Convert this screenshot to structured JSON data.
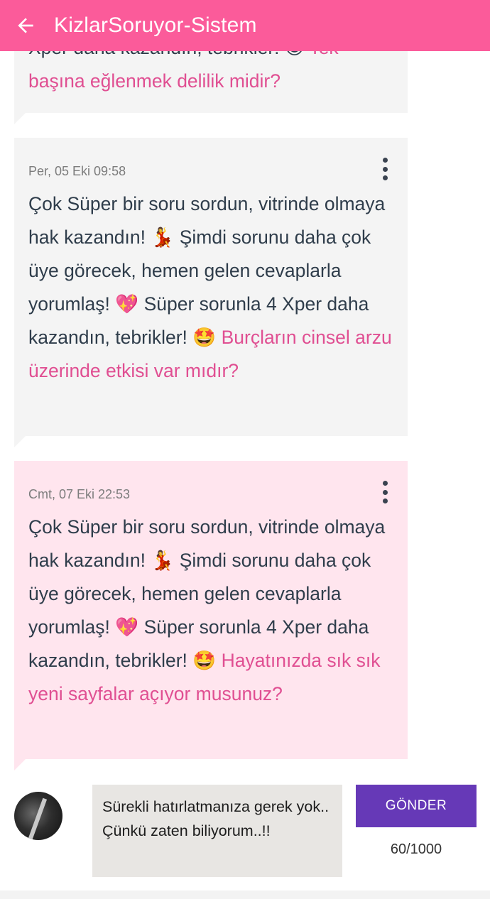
{
  "colors": {
    "appbar": "#fb5b9a",
    "link": "#e04f92",
    "bubble_grey": "#f4f4f4",
    "bubble_pink": "#ffe5ee",
    "send_button": "#6639b7"
  },
  "appbar": {
    "back_icon": "arrow-left-icon",
    "title": "KizlarSoruyor-Sistem"
  },
  "messages": [
    {
      "date": "",
      "text_visible_fragment": "Xper daha kazandın, tebrikler! 😊",
      "link_fragment": "Tek",
      "link": "başına eğlenmek delilik midir?"
    },
    {
      "date": "Per, 05 Eki 09:58",
      "menu_icon": "more-vertical-icon",
      "text": "Çok Süper bir soru sordun, vitrinde olmaya hak kazandın! 💃 Şimdi sorunu daha çok üye görecek, hemen gelen cevaplarla yorumlaş! 💖 Süper sorunla 4 Xper daha kazandın, tebrikler! 🤩",
      "link": "Burçların cinsel arzu üzerinde etkisi var mıdır?"
    },
    {
      "date": "Cmt, 07 Eki 22:53",
      "menu_icon": "more-vertical-icon",
      "text": "Çok Süper bir soru sordun, vitrinde olmaya hak kazandın! 💃 Şimdi sorunu daha çok üye görecek, hemen gelen cevaplarla yorumlaş! 💖 Süper sorunla 4 Xper daha kazandın, tebrikler! 🤩",
      "link": "Hayatınızda sık sık yeni sayfalar açıyor musunuz?"
    }
  ],
  "composer": {
    "input_value": "Sürekli hatırlatmanıza gerek yok.. Çünkü zaten biliyorum..!!",
    "send_label": "GÖNDER",
    "char_count": "60/1000"
  }
}
